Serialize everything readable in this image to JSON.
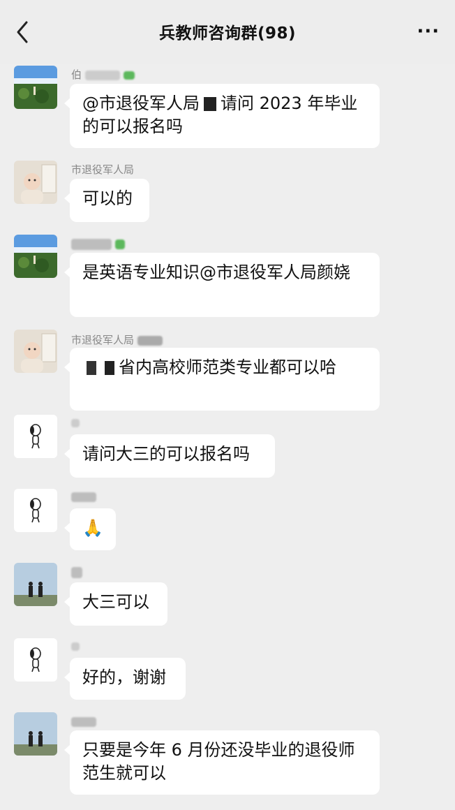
{
  "header": {
    "title": "兵教师咨询群(98)",
    "back_icon": "chevron-left-icon",
    "more_label": "···"
  },
  "messages": [
    {
      "sender": "伯",
      "avatar": "landscape-avatar",
      "text_before": "@市退役军人局",
      "text_after": "请问 2023 年毕业的可以报名吗"
    },
    {
      "sender": "市退役军人局",
      "avatar": "baby-avatar",
      "text": "可以的"
    },
    {
      "sender": "",
      "avatar": "landscape-avatar",
      "text": "是英语专业知识@市退役军人局颜娆"
    },
    {
      "sender": "市退役军人局",
      "avatar": "baby-avatar",
      "text": "省内高校师范类专业都可以哈"
    },
    {
      "sender": "",
      "avatar": "snoopy-avatar",
      "text": "请问大三的可以报名吗"
    },
    {
      "sender": "",
      "avatar": "snoopy-avatar",
      "text": "🙏"
    },
    {
      "sender": "",
      "avatar": "couple-avatar",
      "text": "大三可以"
    },
    {
      "sender": "",
      "avatar": "snoopy-avatar",
      "text": "好的，谢谢"
    },
    {
      "sender": "",
      "avatar": "couple-avatar",
      "text": "只要是今年 6 月份还没毕业的退役师范生就可以"
    }
  ]
}
